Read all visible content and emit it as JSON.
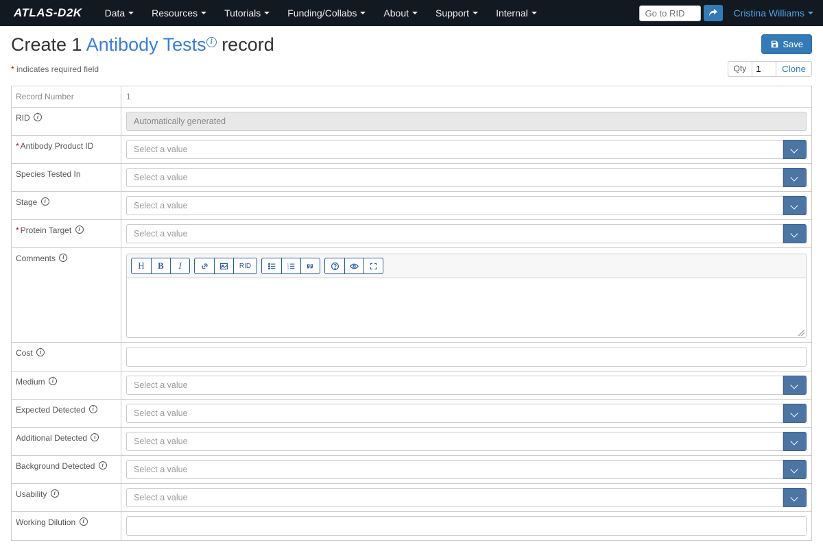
{
  "navbar": {
    "brand": "ATLAS-D2K",
    "items": [
      "Data",
      "Resources",
      "Tutorials",
      "Funding/Collabs",
      "About",
      "Support",
      "Internal"
    ],
    "rid_placeholder": "Go to RID",
    "user": "Cristina Williams"
  },
  "title": {
    "prefix": "Create 1 ",
    "link": "Antibody Tests",
    "suffix": " record"
  },
  "buttons": {
    "save": "Save",
    "clone": "Clone",
    "qty_label": "Qty",
    "qty_value": "1"
  },
  "subtitle": {
    "req_note": "indicates required field"
  },
  "header_row": {
    "label": "Record Number",
    "value": "1"
  },
  "fields": {
    "rid": {
      "label": "RID",
      "placeholder": "Automatically generated"
    },
    "antibody_product_id": {
      "label": "Antibody Product ID",
      "placeholder": "Select a value",
      "required": true
    },
    "species_tested_in": {
      "label": "Species Tested In",
      "placeholder": "Select a value"
    },
    "stage": {
      "label": "Stage",
      "placeholder": "Select a value"
    },
    "protein_target": {
      "label": "Protein Target",
      "placeholder": "Select a value",
      "required": true
    },
    "comments": {
      "label": "Comments"
    },
    "cost": {
      "label": "Cost"
    },
    "medium": {
      "label": "Medium",
      "placeholder": "Select a value"
    },
    "expected_detected": {
      "label": "Expected Detected",
      "placeholder": "Select a value"
    },
    "additional_detected": {
      "label": "Additional Detected",
      "placeholder": "Select a value"
    },
    "background_detected": {
      "label": "Background Detected",
      "placeholder": "Select a value"
    },
    "usability": {
      "label": "Usability",
      "placeholder": "Select a value"
    },
    "working_dilution": {
      "label": "Working Dilution"
    }
  },
  "toolbar_rid": "RID"
}
